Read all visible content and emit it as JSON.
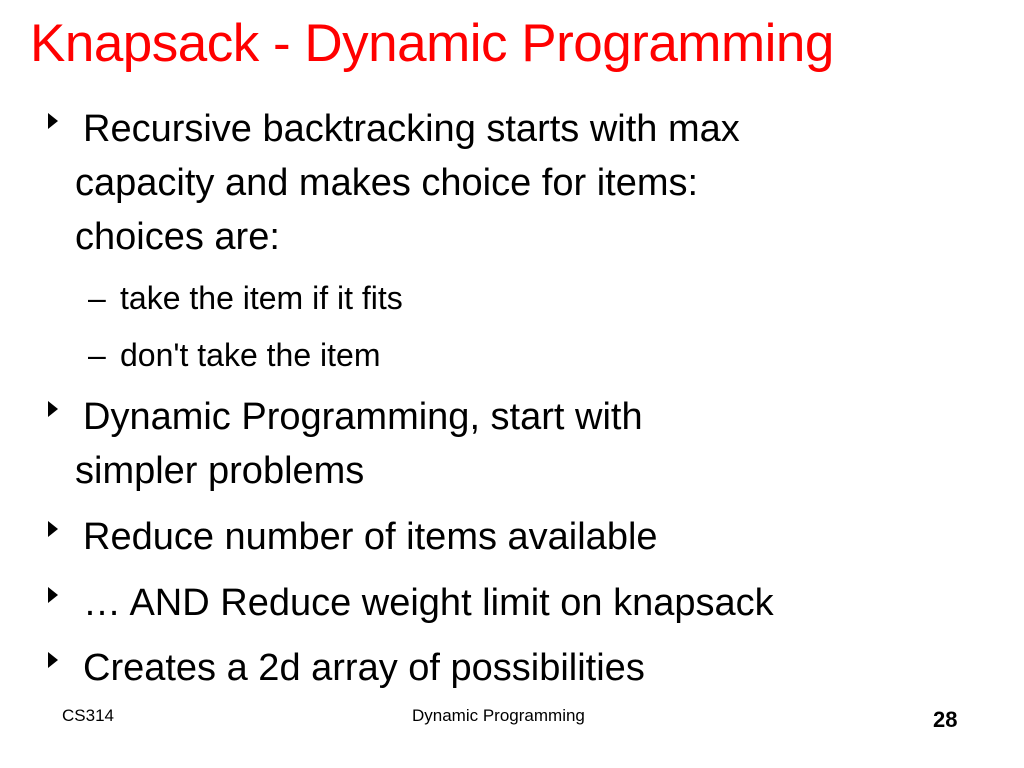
{
  "slide": {
    "title": "Knapsack - Dynamic Programming",
    "bullets": [
      {
        "lines": [
          "Recursive backtracking starts with max",
          "capacity and makes choice for items:",
          "choices are:"
        ]
      },
      {
        "lines": [
          "Dynamic Programming, start with",
          "simpler problems"
        ]
      },
      {
        "lines": [
          "Reduce number of items available"
        ]
      },
      {
        "lines": [
          "… AND Reduce weight limit on knapsack"
        ]
      },
      {
        "lines": [
          "Creates a 2d array of possibilities"
        ]
      }
    ],
    "sub_bullets": [
      {
        "dash": "–",
        "text": "take the item if it fits"
      },
      {
        "dash": "–",
        "text": "don't take the item"
      }
    ]
  },
  "footer": {
    "left": "CS314",
    "center": "Dynamic Programming",
    "page_number": "28"
  },
  "colors": {
    "title": "#ff0000",
    "text": "#000000",
    "background": "#ffffff"
  }
}
